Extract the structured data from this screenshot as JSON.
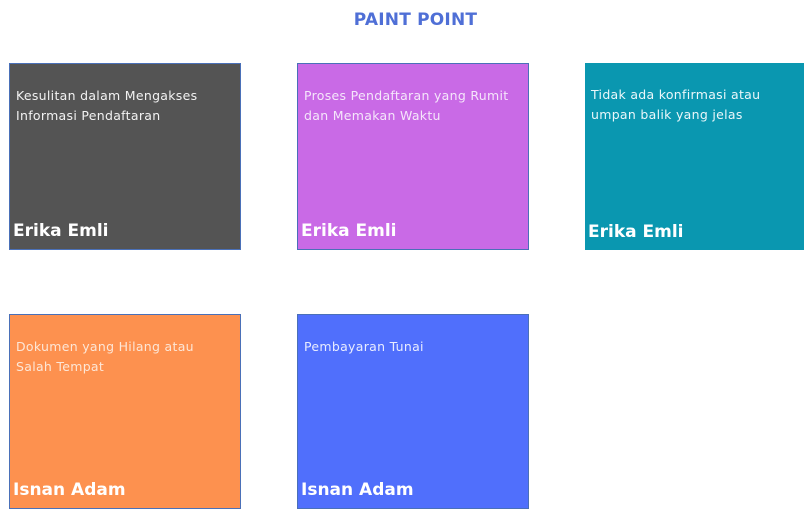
{
  "title": "PAINT POINT",
  "notes": [
    {
      "text": "Kesulitan dalam Mengakses\nInformasi Pendaftaran",
      "author": "Erika Emli",
      "bg": "#545454",
      "text_color": "#f2f2f2"
    },
    {
      "text": "Proses Pendaftaran yang Rumit\ndan Memakan Waktu",
      "author": "Erika Emli",
      "bg": "#c96ae6",
      "text_color": "#f5e6fb"
    },
    {
      "text": "Tidak ada konfirmasi atau\numpan balik yang jelas",
      "author": "Erika Emli",
      "bg": "#0a97b0",
      "text_color": "#eaf7fa"
    },
    {
      "text": "Dokumen yang Hilang atau\nSalah Tempat",
      "author": "Isnan Adam",
      "bg": "#fd914f",
      "text_color": "#fde6d6"
    },
    {
      "text": "Pembayaran Tunai",
      "author": "Isnan Adam",
      "bg": "#506ffc",
      "text_color": "#e8ecff"
    }
  ]
}
